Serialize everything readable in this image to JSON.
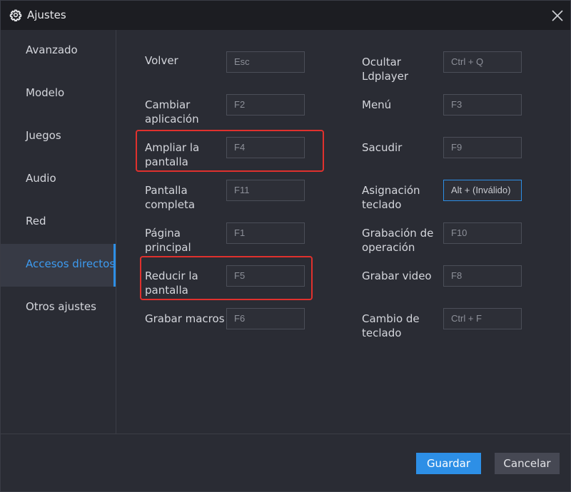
{
  "window": {
    "title": "Ajustes",
    "title_icon": "gear-icon",
    "close_icon": "close-icon"
  },
  "sidebar": {
    "items": [
      {
        "label": "Avanzado"
      },
      {
        "label": "Modelo"
      },
      {
        "label": "Juegos"
      },
      {
        "label": "Audio"
      },
      {
        "label": "Red"
      },
      {
        "label": "Accesos directos",
        "active": true
      },
      {
        "label": "Otros ajustes"
      }
    ]
  },
  "shortcuts": {
    "left": [
      {
        "label": "Volver",
        "value": "Esc"
      },
      {
        "label": "Cambiar aplicación",
        "value": "F2"
      },
      {
        "label": "Ampliar la pantalla",
        "value": "F4"
      },
      {
        "label": "Pantalla completa",
        "value": "F11"
      },
      {
        "label": "Página principal",
        "value": "F1"
      },
      {
        "label": "Reducir la pantalla",
        "value": "F5"
      },
      {
        "label": "Grabar macros",
        "value": "F6"
      }
    ],
    "right": [
      {
        "label": "Ocultar Ldplayer",
        "value": "Ctrl + Q"
      },
      {
        "label": "Menú",
        "value": "F3"
      },
      {
        "label": "Sacudir",
        "value": "F9"
      },
      {
        "label": "Asignación teclado",
        "value": "Alt + (Inválido)",
        "focused": true
      },
      {
        "label": "Grabación de operación",
        "value": "F10"
      },
      {
        "label": "Grabar video",
        "value": "F8"
      },
      {
        "label": "Cambio de teclado",
        "value": "Ctrl + F"
      }
    ]
  },
  "footer": {
    "save_label": "Guardar",
    "cancel_label": "Cancelar"
  },
  "colors": {
    "accent": "#2d8fe6",
    "highlight_border": "#e0312d",
    "background": "#2a2c34",
    "titlebar": "#1c1d22"
  }
}
